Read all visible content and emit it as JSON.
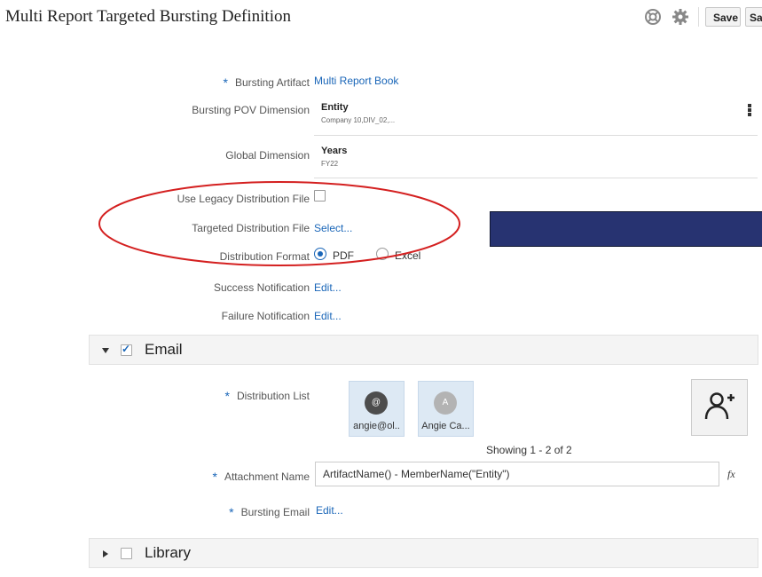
{
  "header": {
    "title": "Multi Report Targeted Bursting Definition",
    "save_label": "Save",
    "save_as_label": "Save As"
  },
  "form": {
    "bursting_artifact": {
      "label": "Bursting Artifact",
      "value": "Multi Report Book"
    },
    "bursting_pov_dimension": {
      "label": "Bursting POV Dimension",
      "name": "Entity",
      "members": "Company 10,DIV_02,..."
    },
    "global_dimension": {
      "label": "Global Dimension",
      "name": "Years",
      "members": "FY22"
    },
    "use_legacy": {
      "label": "Use Legacy Distribution File",
      "checked": false
    },
    "targeted_file": {
      "label": "Targeted Distribution File",
      "value": "Select..."
    },
    "distribution_format": {
      "label": "Distribution Format",
      "options": [
        "PDF",
        "Excel"
      ],
      "selected": "PDF"
    },
    "success_notification": {
      "label": "Success Notification",
      "value": "Edit..."
    },
    "failure_notification": {
      "label": "Failure Notification",
      "value": "Edit..."
    }
  },
  "email_section": {
    "title": "Email",
    "expanded": true,
    "checked": true,
    "distribution_list_label": "Distribution List",
    "recipients": [
      {
        "initial": "@",
        "name": "angie@ol..",
        "avatar_color": "#4d4d4d"
      },
      {
        "initial": "A",
        "name": "Angie Ca...",
        "avatar_color": "#b3b3b3"
      }
    ],
    "showing": "Showing 1 - 2 of 2",
    "attachment_name_label": "Attachment Name",
    "attachment_name_value": "ArtifactName() - MemberName(\"Entity\")",
    "fx_label": "fx",
    "bursting_email_label": "Bursting Email",
    "bursting_email_value": "Edit..."
  },
  "library_section": {
    "title": "Library",
    "expanded": false,
    "checked": false
  },
  "colors": {
    "link": "#1a66b8",
    "annotation_ellipse": "#d42020",
    "redaction_bar": "#273371"
  },
  "icons": [
    "help-icon",
    "gear-icon",
    "add-user-icon",
    "fx-icon"
  ]
}
